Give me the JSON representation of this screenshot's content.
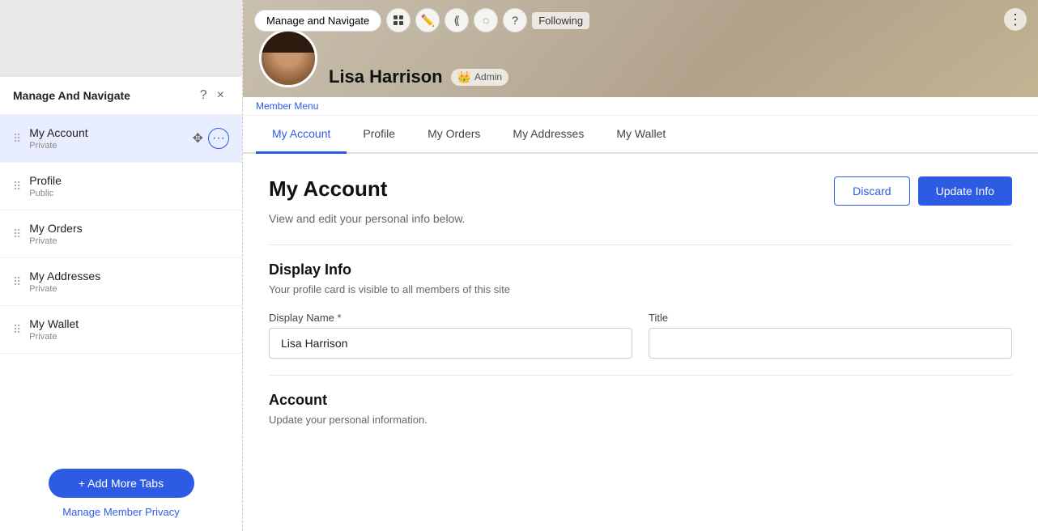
{
  "leftPanel": {
    "header": {
      "title": "Manage And Navigate",
      "help_icon": "?",
      "close_icon": "×"
    },
    "navItems": [
      {
        "id": "my-account",
        "name": "My Account",
        "privacy": "Private",
        "active": true
      },
      {
        "id": "profile",
        "name": "Profile",
        "privacy": "Public",
        "active": false
      },
      {
        "id": "my-orders",
        "name": "My Orders",
        "privacy": "Private",
        "active": false
      },
      {
        "id": "my-addresses",
        "name": "My Addresses",
        "privacy": "Private",
        "active": false
      },
      {
        "id": "my-wallet",
        "name": "My Wallet",
        "privacy": "Private",
        "active": false
      }
    ],
    "footer": {
      "addTabsLabel": "+ Add More Tabs",
      "managePrivacyLabel": "Manage Member Privacy"
    }
  },
  "profileHeader": {
    "name": "Lisa Harrison",
    "adminBadge": "Admin",
    "toolbarButtons": {
      "manageNavigate": "Manage and Navigate",
      "following": "ollowing"
    }
  },
  "memberMenuLabel": "Member Menu",
  "tabs": [
    {
      "id": "my-account",
      "label": "My Account",
      "active": true
    },
    {
      "id": "profile",
      "label": "Profile",
      "active": false
    },
    {
      "id": "my-orders",
      "label": "My Orders",
      "active": false
    },
    {
      "id": "my-addresses",
      "label": "My Addresses",
      "active": false
    },
    {
      "id": "my-wallet",
      "label": "My Wallet",
      "active": false
    }
  ],
  "mainContent": {
    "pageTitle": "My Account",
    "pageSubtitle": "View and edit your personal info below.",
    "discardLabel": "Discard",
    "updateLabel": "Update Info",
    "displayInfo": {
      "sectionTitle": "Display Info",
      "sectionSubtitle": "Your profile card is visible to all members of this site",
      "displayNameLabel": "Display Name *",
      "displayNameValue": "Lisa Harrison",
      "displayNamePlaceholder": "Lisa Harrison",
      "titleLabel": "Title",
      "titleValue": "",
      "titlePlaceholder": ""
    },
    "account": {
      "sectionTitle": "Account",
      "sectionSubtitle": "Update your personal information."
    }
  }
}
